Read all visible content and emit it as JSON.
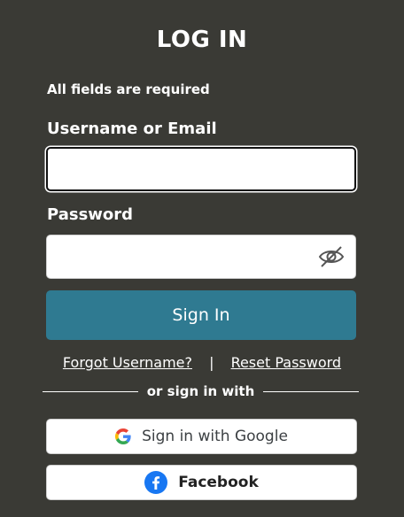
{
  "title": "LOG IN",
  "required_note": "All fields are required",
  "username": {
    "label": "Username or Email",
    "value": "",
    "placeholder": ""
  },
  "password": {
    "label": "Password",
    "value": "",
    "placeholder": "",
    "toggle_icon": "eye-slash-icon"
  },
  "signin_button": "Sign In",
  "links": {
    "forgot_username": "Forgot Username?",
    "separator": "|",
    "reset_password": "Reset Password"
  },
  "divider_text": "or sign in with",
  "social": {
    "google_label": "Sign in with Google",
    "facebook_label": "Facebook"
  },
  "colors": {
    "background": "#3a3a35",
    "primary_button": "#2f7a91",
    "facebook_blue": "#1877f2"
  }
}
